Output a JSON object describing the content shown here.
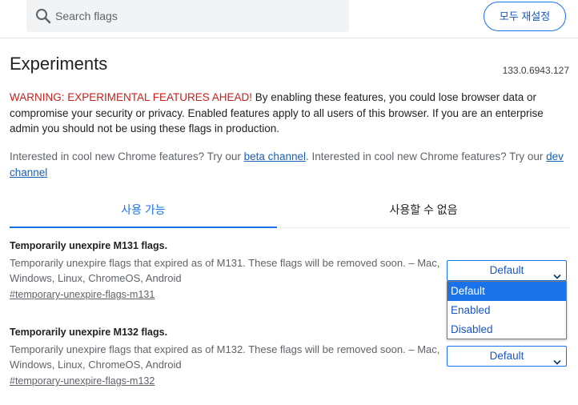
{
  "search": {
    "placeholder": "Search flags",
    "icon": "search-icon"
  },
  "header": {
    "reset_label": "모두 재설정"
  },
  "page": {
    "title": "Experiments",
    "version": "133.0.6943.127",
    "warning_strong": "WARNING: EXPERIMENTAL FEATURES AHEAD!",
    "warning_rest": " By enabling these features, you could lose browser data or compromise your security or privacy. Enabled features apply to all users of this browser. If you are an enterprise admin you should not be using these flags in production.",
    "interest_1": "Interested in cool new Chrome features? Try our ",
    "beta_link": "beta channel",
    "interest_2": ". Interested in cool new Chrome features? Try our ",
    "dev_link": "dev channel"
  },
  "tabs": [
    {
      "label": "사용 가능",
      "active": true
    },
    {
      "label": "사용할 수 없음",
      "active": false
    }
  ],
  "experiments": [
    {
      "title": "Temporarily unexpire M131 flags.",
      "description": "Temporarily unexpire flags that expired as of M131. These flags will be removed soon. – Mac, Windows, Linux, ChromeOS, Android",
      "link": "#temporary-unexpire-flags-m131",
      "value": "Default"
    },
    {
      "title": "Temporarily unexpire M132 flags.",
      "description": "Temporarily unexpire flags that expired as of M132. These flags will be removed soon. – Mac, Windows, Linux, ChromeOS, Android",
      "link": "#temporary-unexpire-flags-m132",
      "value": "Default"
    }
  ],
  "dropdown": {
    "options": [
      "Default",
      "Enabled",
      "Disabled"
    ],
    "selected": "Default"
  },
  "colors": {
    "accent": "#1a73e8",
    "warning": "#c5221f",
    "link": "#1a5fb4"
  }
}
